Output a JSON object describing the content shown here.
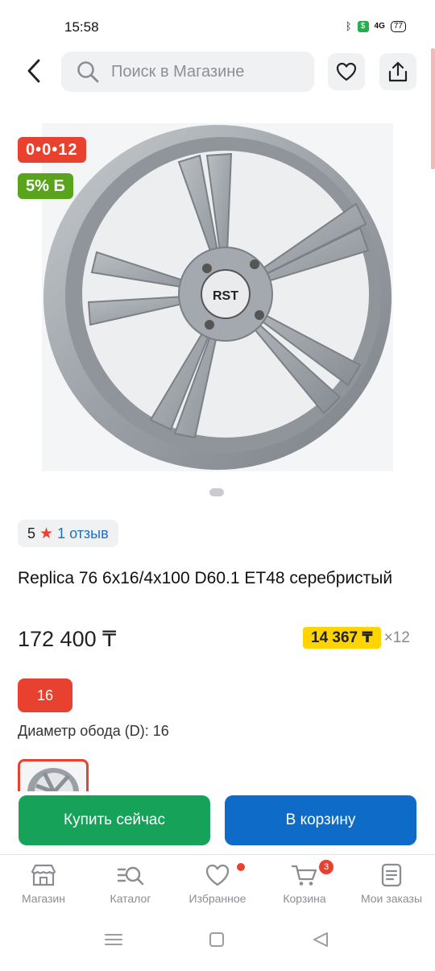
{
  "status": {
    "time": "15:58",
    "network": "4G",
    "battery": "77"
  },
  "header": {
    "search_placeholder": "Поиск в Магазине"
  },
  "product": {
    "badge_installment": "0•0•12",
    "badge_cashback": "5% Б",
    "rating": "5",
    "reviews": "1 отзыв",
    "title": "Replica 76 6x16/4x100 D60.1 ET48 серебристый",
    "price": "172 400 ₸",
    "installment_price": "14 367 ₸",
    "installment_mult": "×12",
    "size_chip": "16",
    "attribute": "Диаметр обода (D): 16",
    "rim_logo": "RST"
  },
  "actions": {
    "buy_now": "Купить сейчас",
    "add_to_cart": "В корзину"
  },
  "nav": {
    "items": [
      {
        "label": "Магазин",
        "icon": "store-icon"
      },
      {
        "label": "Каталог",
        "icon": "catalog-search-icon"
      },
      {
        "label": "Избранное",
        "icon": "heart-icon"
      },
      {
        "label": "Корзина",
        "icon": "cart-icon"
      },
      {
        "label": "Мои заказы",
        "icon": "orders-icon"
      }
    ],
    "cart_count": "3"
  },
  "colors": {
    "accent_red": "#e8412f",
    "buy_green": "#17a25a",
    "cart_blue": "#0e6bc8",
    "installment_yellow": "#ffd400"
  }
}
